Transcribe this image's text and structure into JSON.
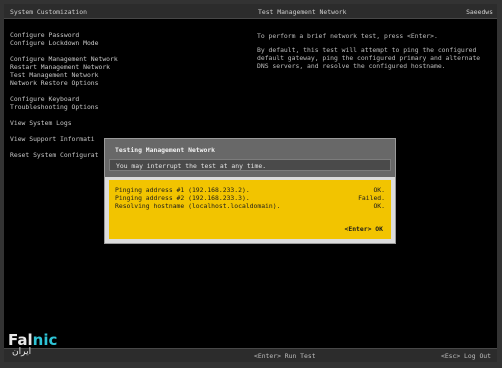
{
  "topbar": {
    "left_title": "System Customization",
    "mid_title": "Test Management Network",
    "right_user": "Saeedws"
  },
  "menu": {
    "items": [
      {
        "label": "Configure Password"
      },
      {
        "label": "Configure Lockdown Mode"
      },
      {
        "label": "Configure Management Network"
      },
      {
        "label": "Restart Management Network"
      },
      {
        "label": "Test Management Network"
      },
      {
        "label": "Network Restore Options"
      },
      {
        "label": "Configure Keyboard"
      },
      {
        "label": "Troubleshooting Options"
      },
      {
        "label": "View System Logs"
      },
      {
        "label": "View Support Informati"
      },
      {
        "label": "Reset System Configurat"
      }
    ]
  },
  "help": {
    "line1": "To perform a brief network test, press <Enter>.",
    "line2": "By default, this test will attempt to ping the configured",
    "line3": "default gateway, ping the configured primary and alternate",
    "line4": "DNS servers, and resolve the configured hostname."
  },
  "dialog": {
    "title": "Testing Management Network",
    "subtitle": "You may interrupt the test at any time.",
    "results": [
      {
        "text": "Pinging address #1 (192.168.233.2).",
        "status": "OK."
      },
      {
        "text": "Pinging address #2 (192.168.233.3).",
        "status": "Failed."
      },
      {
        "text": "Resolving hostname (localhost.localdomain).",
        "status": "OK."
      }
    ],
    "ok_label": "<Enter> OK"
  },
  "footer": {
    "run_test": "<Enter> Run Test",
    "log_out": "<Esc> Log Out"
  },
  "watermark": {
    "word_light": "Fal",
    "word_accent": "nic",
    "subtitle": "ایران"
  },
  "colors": {
    "screen_bg": "#000000",
    "dialog_body": "#f2c400",
    "dialog_header": "#686868",
    "logo_accent": "#2ec4d6"
  }
}
